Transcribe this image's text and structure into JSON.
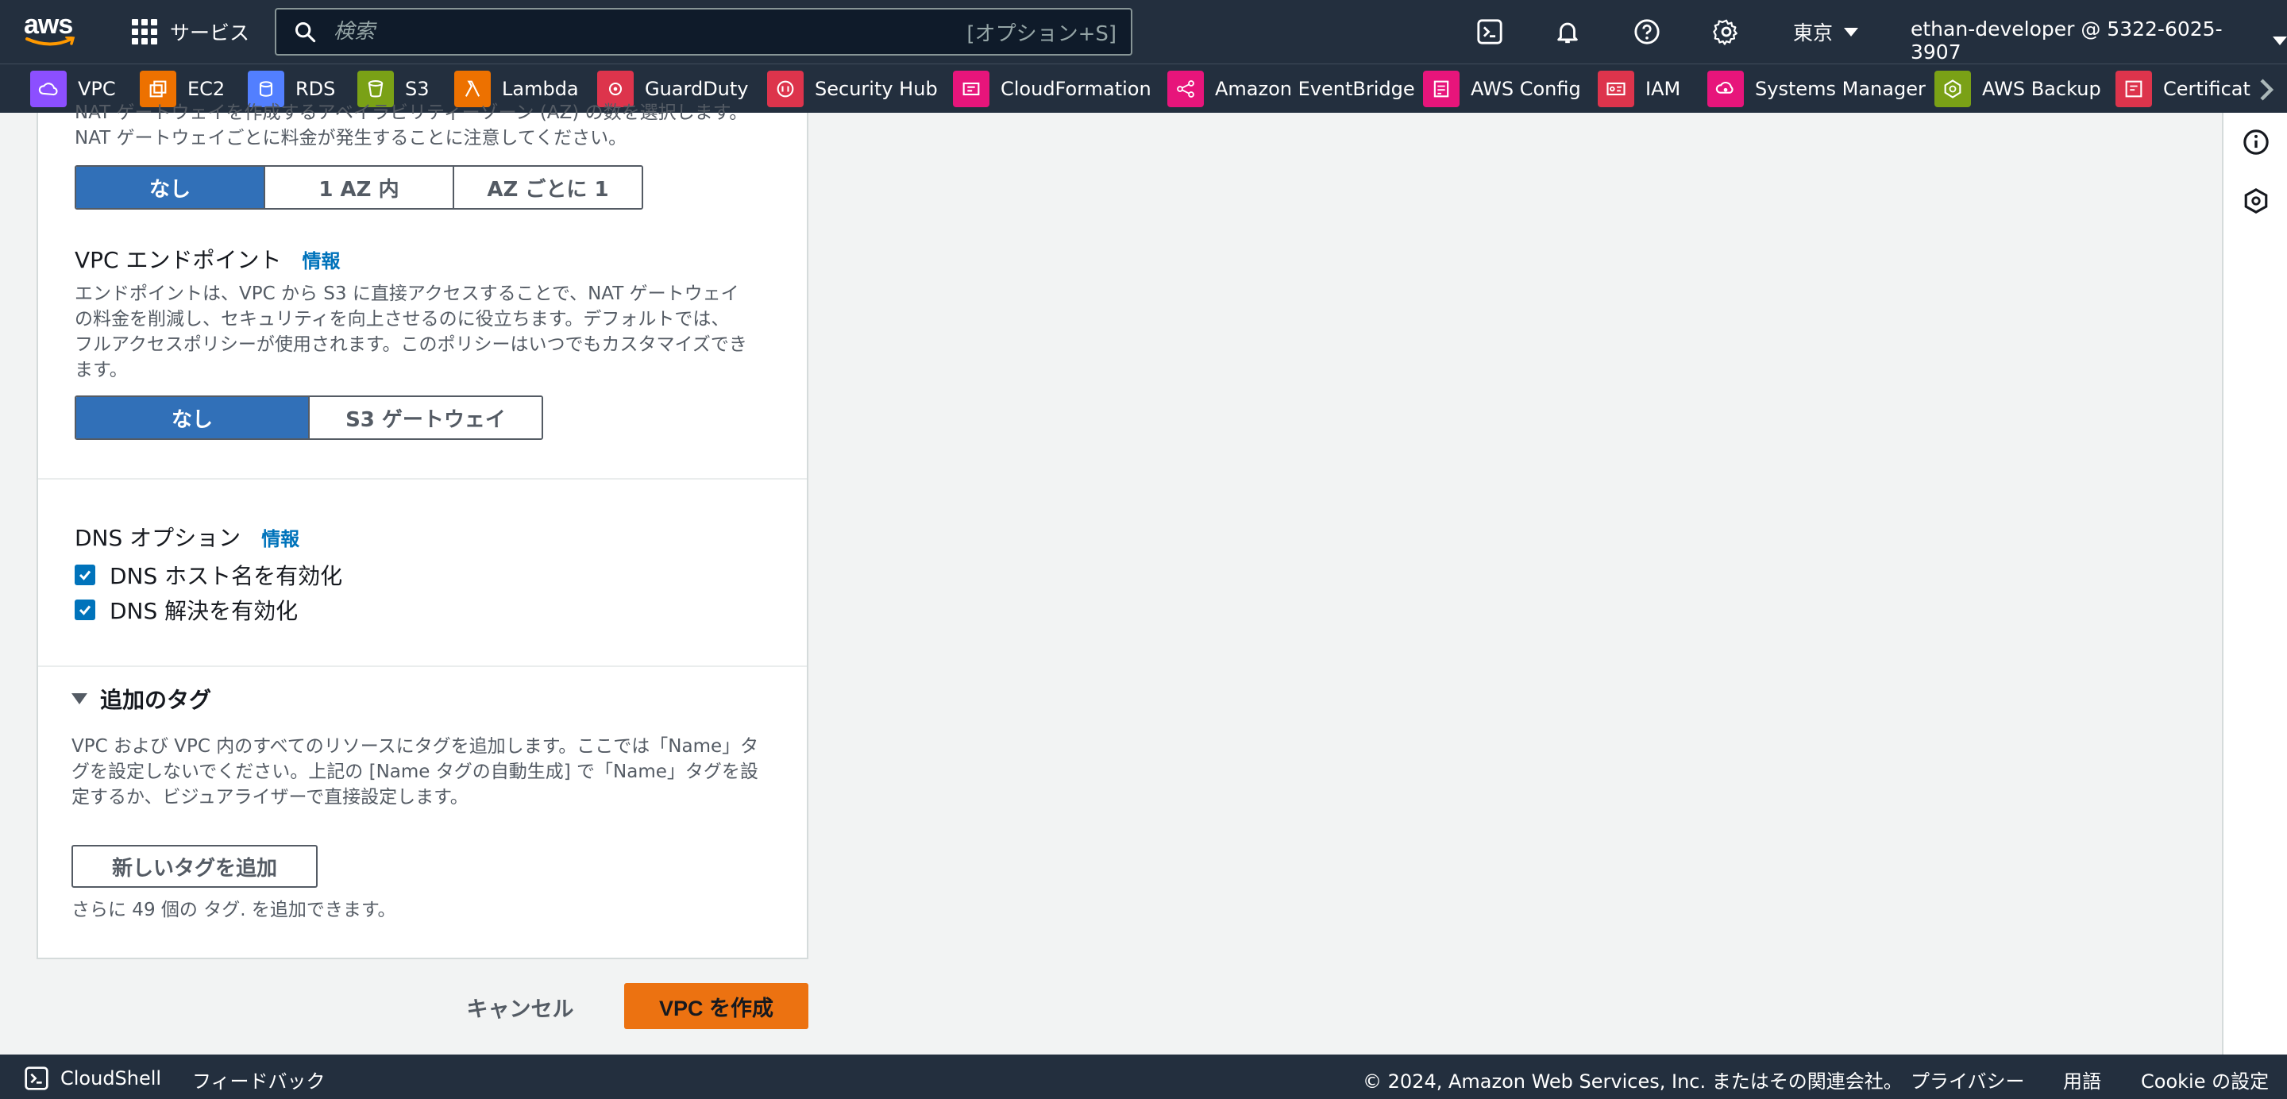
{
  "header": {
    "logo_text": "aws",
    "services_label": "サービス",
    "search_placeholder": "検索",
    "search_shortcut": "[オプション+S]",
    "region": "東京",
    "account": "ethan-developer @ 5322-6025-3907"
  },
  "favorites": [
    {
      "label": "VPC",
      "color": "#8c4fff"
    },
    {
      "label": "EC2",
      "color": "#ed7100"
    },
    {
      "label": "RDS",
      "color": "#527fff"
    },
    {
      "label": "S3",
      "color": "#7aa116"
    },
    {
      "label": "Lambda",
      "color": "#ed7100"
    },
    {
      "label": "GuardDuty",
      "color": "#dd344c"
    },
    {
      "label": "Security Hub",
      "color": "#dd344c"
    },
    {
      "label": "CloudFormation",
      "color": "#e7157b"
    },
    {
      "label": "Amazon EventBridge",
      "color": "#e7157b"
    },
    {
      "label": "AWS Config",
      "color": "#e7157b"
    },
    {
      "label": "IAM",
      "color": "#dd344c"
    },
    {
      "label": "Systems Manager",
      "color": "#e7157b"
    },
    {
      "label": "AWS Backup",
      "color": "#7aa116"
    },
    {
      "label": "Certificat",
      "color": "#dd344c"
    }
  ],
  "nat": {
    "desc_line1": "NAT ゲートウェイを作成するアベイラビリティーゾーン (AZ) の数を選択します。",
    "desc_line2": "NAT ゲートウェイごとに料金が発生することに注意してください。",
    "options": [
      "なし",
      "1 AZ 内",
      "AZ ごとに 1"
    ],
    "selected": "なし"
  },
  "endpoint": {
    "title": "VPC エンドポイント",
    "info": "情報",
    "desc_line1": "エンドポイントは、VPC から S3 に直接アクセスすることで、NAT ゲートウェイ",
    "desc_line2": "の料金を削減し、セキュリティを向上させるのに役立ちます。デフォルトでは、",
    "desc_line3": "フルアクセスポリシーが使用されます。このポリシーはいつでもカスタマイズでき",
    "desc_line4": "ます。",
    "options": [
      "なし",
      "S3 ゲートウェイ"
    ],
    "selected": "なし"
  },
  "dns": {
    "title": "DNS オプション",
    "info": "情報",
    "hostnames": "DNS ホスト名を有効化",
    "resolution": "DNS 解決を有効化"
  },
  "tags": {
    "title": "追加のタグ",
    "desc_line1": "VPC および VPC 内のすべてのリソースにタグを追加します。ここでは「Name」タ",
    "desc_line2": "グを設定しないでください。上記の [Name タグの自動生成] で「Name」タグを設",
    "desc_line3": "定するか、ビジュアライザーで直接設定します。",
    "add_button": "新しいタグを追加",
    "hint": "さらに 49 個の タグ. を追加できます。"
  },
  "actions": {
    "cancel": "キャンセル",
    "create": "VPC を作成"
  },
  "footer": {
    "cloudshell": "CloudShell",
    "feedback": "フィードバック",
    "copyright": "© 2024, Amazon Web Services, Inc. またはその関連会社。",
    "privacy": "プライバシー",
    "terms": "用語",
    "cookie": "Cookie の設定"
  }
}
